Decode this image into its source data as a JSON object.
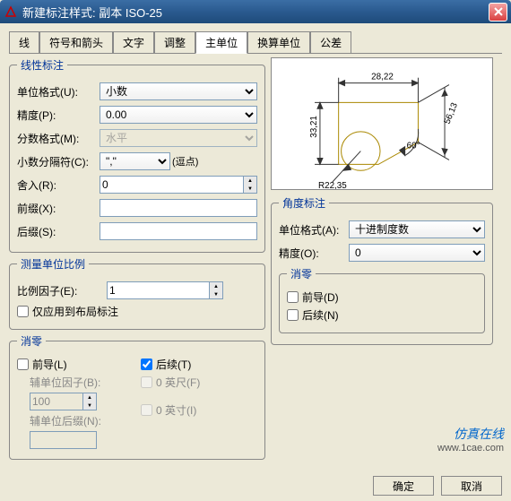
{
  "window": {
    "title": "新建标注样式: 副本 ISO-25",
    "close": "X"
  },
  "tabs": {
    "t1": "线",
    "t2": "符号和箭头",
    "t3": "文字",
    "t4": "调整",
    "t5": "主单位",
    "t6": "换算单位",
    "t7": "公差"
  },
  "linear": {
    "legend": "线性标注",
    "unitFormatLabel": "单位格式(U):",
    "unitFormat": "小数",
    "precisionLabel": "精度(P):",
    "precision": "0.00",
    "fracFormatLabel": "分数格式(M):",
    "fracFormat": "水平",
    "decimalSepLabel": "小数分隔符(C):",
    "decimalSepVal": "\",\"",
    "decimalSepHint": "(逗点)",
    "roundLabel": "舍入(R):",
    "round": "0",
    "prefixLabel": "前缀(X):",
    "prefix": "",
    "suffixLabel": "后缀(S):",
    "suffix": ""
  },
  "scale": {
    "legend": "测量单位比例",
    "factorLabel": "比例因子(E):",
    "factor": "1",
    "layoutOnly": "仅应用到布局标注"
  },
  "suppressL": {
    "legend": "消零",
    "leading": "前导(L)",
    "subFactorLabel": "辅单位因子(B):",
    "subFactor": "100",
    "subSuffixLabel": "辅单位后缀(N):",
    "subSuffix": "",
    "trailing": "后续(T)",
    "feet": "0 英尺(F)",
    "inches": "0 英寸(I)"
  },
  "angular": {
    "legend": "角度标注",
    "unitFormatLabel": "单位格式(A):",
    "unitFormat": "十进制度数",
    "precisionLabel": "精度(O):",
    "precision": "0"
  },
  "suppressA": {
    "legend": "消零",
    "leading": "前导(D)",
    "trailing": "后续(N)"
  },
  "preview": {
    "dim_top": "28,22",
    "dim_left": "33,21",
    "dim_radius": "R22,35",
    "dim_diag": "56,13",
    "dim_angle": "60°"
  },
  "buttons": {
    "ok": "确定",
    "cancel": "取消"
  },
  "watermark": {
    "text": "仿真在线",
    "url": "www.1cae.com"
  }
}
